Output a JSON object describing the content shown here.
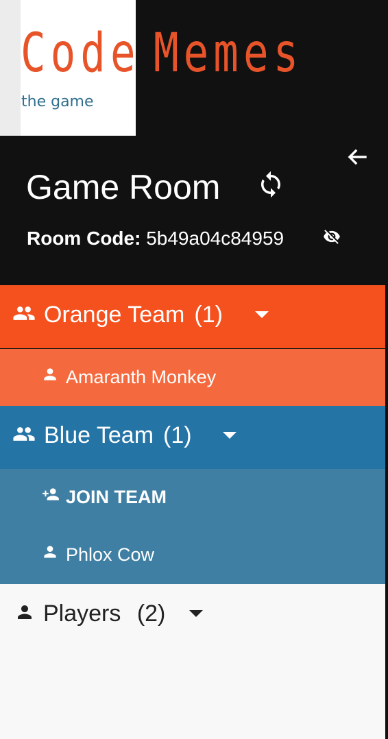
{
  "logo": {
    "word1": "Code",
    "word2": "Memes",
    "subtitle": "the game",
    "accent_color": "#e8542a",
    "subtitle_color": "#2f6e8f"
  },
  "room": {
    "title": "Game Room",
    "code_label": "Room Code:",
    "code_value": "5b49a04c84959",
    "icons": [
      "arrow-left-icon",
      "refresh-icon",
      "eye-off-icon"
    ]
  },
  "teams": [
    {
      "name": "Orange Team",
      "count": "(1)",
      "color": "#f4511e",
      "row_color": "#f46a3e",
      "members": [
        "Amaranth Monkey"
      ]
    },
    {
      "name": "Blue Team",
      "count": "(1)",
      "color": "#2574a6",
      "row_color": "#3f7fa3",
      "join_label": "JOIN TEAM",
      "members": [
        "Phlox Cow"
      ]
    }
  ],
  "players": {
    "label": "Players",
    "count": "(2)"
  }
}
